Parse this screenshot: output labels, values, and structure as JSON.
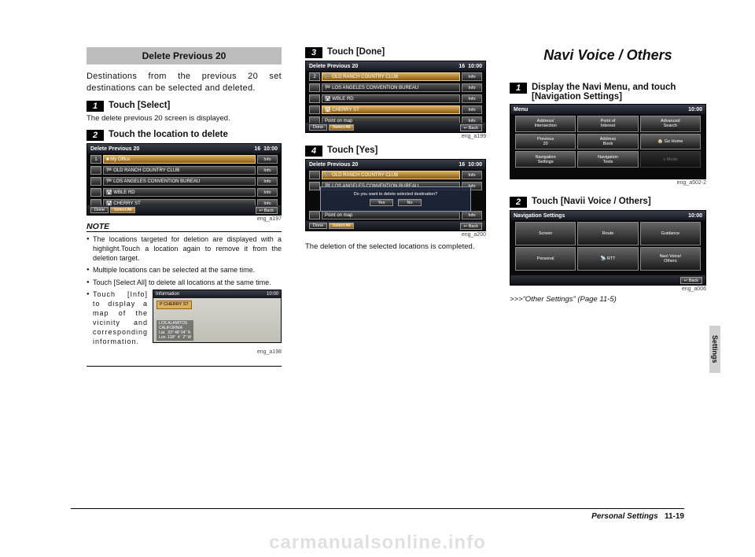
{
  "col1": {
    "section_title": "Delete Previous 20",
    "intro": "Destinations from the previous 20 set destinations can be selected and deleted.",
    "step1": {
      "num": "1",
      "label": "Touch [Select]"
    },
    "step1_sub": "The delete previous 20 screen is displayed.",
    "step2": {
      "num": "2",
      "label": "Touch the location to delete"
    },
    "shot1": {
      "title": "Delete Previous 20",
      "count": "16",
      "time": "10:00",
      "items": [
        {
          "idx": "1",
          "name": "■ My Office",
          "hl": true
        },
        {
          "idx": "",
          "name": "🏁 OLD RANCH COUNTRY CLUB",
          "hl": false
        },
        {
          "idx": "",
          "name": "🏁 LOS ANGELES CONVENTION BUREAU",
          "hl": false
        },
        {
          "idx": "",
          "name": "🛣 WBLE RD",
          "hl": false
        },
        {
          "idx": "",
          "name": "🛣 CHERRY ST",
          "hl": false
        }
      ],
      "info": "Info",
      "done": "Done",
      "select_all": "Select All",
      "back": "↩ Back"
    },
    "caption1": "eng_a197",
    "note_heading": "NOTE",
    "notes": [
      "The locations targeted for deletion are displayed with a highlight.Touch a location again to remove it from the deletion target.",
      "Multiple locations can be selected at the same time.",
      "Touch [Select All] to delete all locations at the same time."
    ],
    "note_info": "Touch [Info] to display a map of the vicinity and corresponding information.",
    "map": {
      "title": "Information",
      "time": "10:00",
      "label": "P CHERRY ST",
      "info1": "LOS ALAMITOS",
      "info2": "CALIFORNIA",
      "coords": "Lat.  33° 48' 04\" N\nLon. 118°  4'  2\" W"
    },
    "caption2": "eng_a198"
  },
  "col2": {
    "step3": {
      "num": "3",
      "label": "Touch [Done]"
    },
    "shot3": {
      "title": "Delete Previous 20",
      "count": "16",
      "time": "10:00",
      "items": [
        {
          "idx": "2",
          "name": "🏁 OLD RANCH COUNTRY CLUB",
          "hl": true
        },
        {
          "idx": "",
          "name": "🏁 LOS ANGELES CONVENTION BUREAU",
          "hl": false
        },
        {
          "idx": "",
          "name": "🛣 WBLE RD",
          "hl": false
        },
        {
          "idx": "",
          "name": "🛣 CHERRY ST",
          "hl": true
        },
        {
          "idx": "",
          "name": "Point on map",
          "hl": false
        }
      ],
      "info": "Info",
      "done": "Done",
      "select_all": "Select All",
      "back": "↩ Back"
    },
    "caption3": "eng_a199",
    "step4": {
      "num": "4",
      "label": "Touch [Yes]"
    },
    "shot4": {
      "title": "Delete Previous 20",
      "count": "16",
      "time": "10:00",
      "row1": "🏁 OLD RANCH COUNTRY CLUB",
      "row2": "🏁 LOS ANGELES CONVENTION BUREAU",
      "confirm_text": "Do you want to delete selected destination?",
      "yes": "Yes",
      "no": "No",
      "bottom_item": "Point on map",
      "info": "Info",
      "done": "Done",
      "select_all": "Select All",
      "back": "↩ Back"
    },
    "caption4": "eng_a200",
    "result": "The deletion of the selected locations is completed."
  },
  "col3": {
    "heading": "Navi Voice / Others",
    "step1": {
      "num": "1",
      "label": "Display the Navi Menu, and touch [Navigation Settings]"
    },
    "shot_menu": {
      "title": "Menu",
      "time": "10:00",
      "tiles": [
        "Address/\nIntersection",
        "Point of\nInterest",
        "Advanced\nSearch",
        "Previous\n20",
        "Address\nBook",
        "🏠 Go Home",
        "Navigation\nSettings",
        "Navigation\nTools",
        "≡ Mode"
      ]
    },
    "caption_menu": "eng_a502-2",
    "step2": {
      "num": "2",
      "label": "Touch [Navii Voice / Others]"
    },
    "shot_nav": {
      "title": "Navigation Settings",
      "time": "10:00",
      "tiles": [
        "Screen",
        "Route",
        "Guidance",
        "Personal",
        "📡 RTT",
        "Navi Voice/\nOthers"
      ],
      "back": "↩ Back"
    },
    "caption_nav": "eng_a006",
    "crossref": ">>>“Other Settings” (Page 11-5)"
  },
  "side_tab": "Settings",
  "footer": {
    "section": "Personal Settings",
    "page": "11-19"
  },
  "watermark": "carmanualsonline.info"
}
